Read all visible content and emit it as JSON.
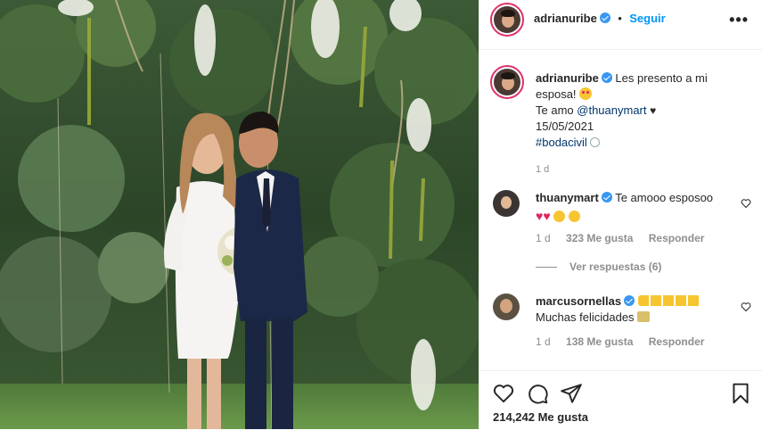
{
  "post": {
    "username": "adrianuribe",
    "follow_label": "Seguir",
    "more_label": "•••",
    "caption_line1": "Les presento a mi esposa!",
    "caption_line2_prefix": "Te amo",
    "caption_mention": "@thuanymart",
    "caption_date": "15/05/2021",
    "caption_hashtag": "#bodacivil",
    "caption_time": "1 d",
    "likes": "214,242 Me gusta"
  },
  "comments": [
    {
      "username": "thuanymart",
      "text": "Te amooo esposoo",
      "time": "1 d",
      "likes": "323 Me gusta",
      "reply": "Responder",
      "view_replies": "Ver respuestas (6)"
    },
    {
      "username": "marcusornellas",
      "text": "Muchas felicidades",
      "time": "1 d",
      "likes": "138 Me gusta",
      "reply": "Responder"
    }
  ],
  "icons": {
    "like": "heart-icon",
    "comment": "comment-icon",
    "share": "send-icon",
    "save": "bookmark-icon",
    "verified": "verified-badge-icon",
    "more": "more-options-icon"
  },
  "colors": {
    "accent": "#0095f6",
    "verified": "#3897f0",
    "story_ring": "#e1306c",
    "muted": "#8e8e8e",
    "text": "#262626"
  }
}
